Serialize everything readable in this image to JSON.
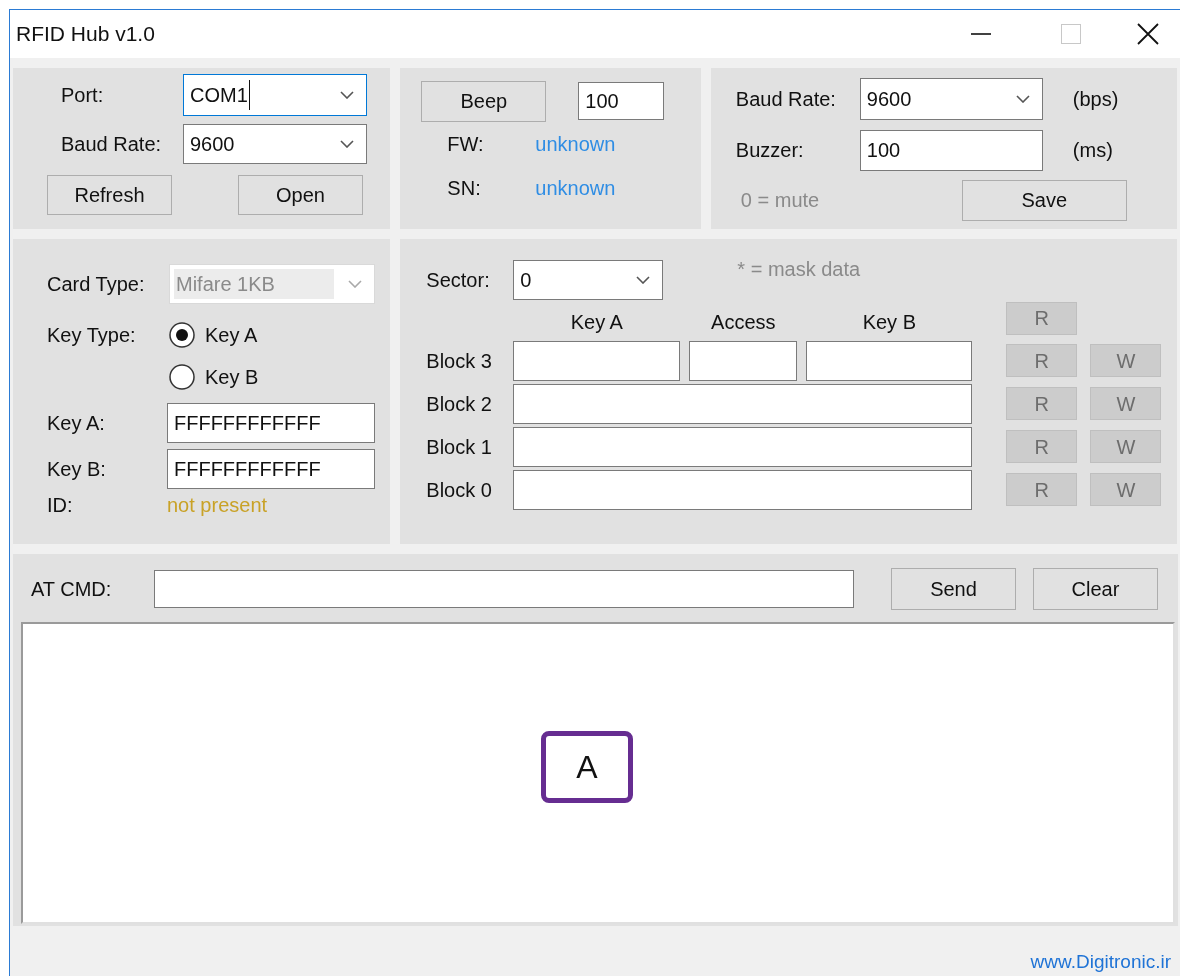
{
  "window": {
    "title": "RFID Hub v1.0"
  },
  "connection": {
    "port_label": "Port:",
    "port_value": "COM1",
    "port_focused": true,
    "baud_label": "Baud Rate:",
    "baud_value": "9600",
    "buttons": [
      "Refresh",
      "Open"
    ]
  },
  "device": {
    "beep_button": "Beep",
    "beep_value": "100",
    "fw_label": "FW:",
    "fw_value": "unknown",
    "sn_label": "SN:",
    "sn_value": "unknown"
  },
  "settings": {
    "baud_label": "Baud Rate:",
    "baud_value": "9600",
    "baud_unit": "(bps)",
    "buzzer_label": "Buzzer:",
    "buzzer_value": "100",
    "buzzer_unit": "(ms)",
    "hint": "0 = mute",
    "save_button": "Save"
  },
  "card": {
    "card_type_label": "Card Type:",
    "card_type_value": "Mifare 1KB",
    "card_type_disabled": true,
    "key_type_label": "Key Type:",
    "key_types": [
      {
        "label": "Key A",
        "selected": true
      },
      {
        "label": "Key B",
        "selected": false
      }
    ],
    "key_a_label": "Key A:",
    "key_a_value": "FFFFFFFFFFFF",
    "key_b_label": "Key B:",
    "key_b_value": "FFFFFFFFFFFF",
    "id_label": "ID:",
    "id_value": "not present"
  },
  "blocks": {
    "sector_label": "Sector:",
    "sector_value": "0",
    "mask_hint": "* = mask data",
    "columns": [
      "Key A",
      "Access",
      "Key B"
    ],
    "trailer_read": {
      "label": "R",
      "disabled": true
    },
    "rows": [
      {
        "label": "Block 3",
        "kind": "trailer",
        "read": "R",
        "write": "W",
        "disabled": true
      },
      {
        "label": "Block 2",
        "kind": "data",
        "read": "R",
        "write": "W",
        "disabled": true
      },
      {
        "label": "Block 1",
        "kind": "data",
        "read": "R",
        "write": "W",
        "disabled": true
      },
      {
        "label": "Block 0",
        "kind": "data",
        "read": "R",
        "write": "W",
        "disabled": true
      }
    ]
  },
  "command": {
    "label": "AT CMD:",
    "buttons": [
      "Send",
      "Clear"
    ]
  },
  "log": {
    "marker": "A"
  },
  "status_bar": {
    "link": "www.Digitronic.ir"
  }
}
